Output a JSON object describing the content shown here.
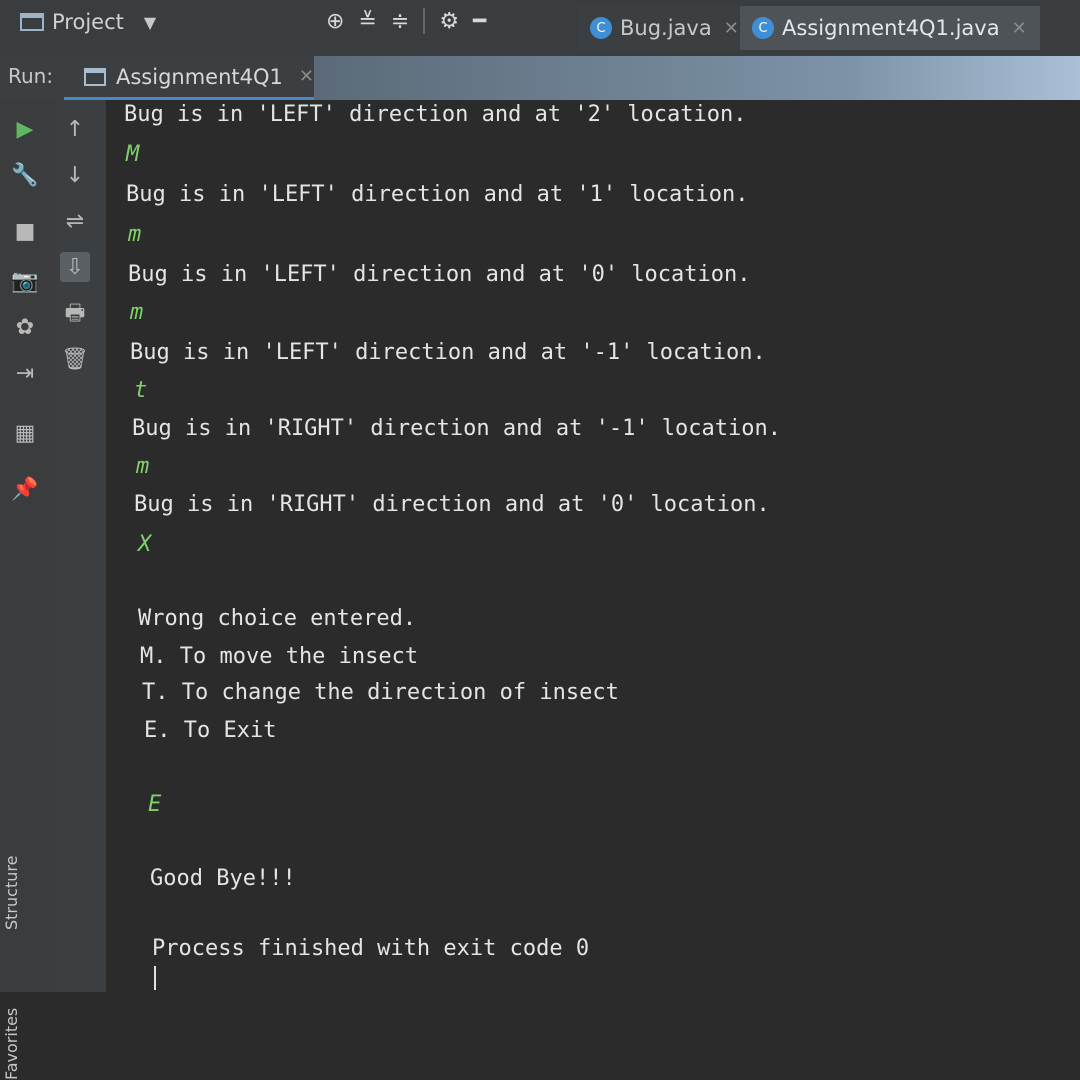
{
  "toolbar": {
    "project_label": "Project",
    "tabs": [
      {
        "name": "Bug.java",
        "icon": "C"
      },
      {
        "name": "Assignment4Q1.java",
        "icon": "C"
      }
    ]
  },
  "run_panel": {
    "label": "Run:",
    "tab_name": "Assignment4Q1",
    "side_labels": {
      "structure": "Structure",
      "favorites": "Favorites"
    }
  },
  "console": {
    "lines": [
      {
        "text": "Bug is in 'LEFT' direction and at '2' location.",
        "kind": "output"
      },
      {
        "text": "M",
        "kind": "input"
      },
      {
        "text": "Bug is in 'LEFT' direction and at '1' location.",
        "kind": "output"
      },
      {
        "text": "m",
        "kind": "input"
      },
      {
        "text": "Bug is in 'LEFT' direction and at '0' location.",
        "kind": "output"
      },
      {
        "text": "m",
        "kind": "input"
      },
      {
        "text": "Bug is in 'LEFT' direction and at '-1' location.",
        "kind": "output"
      },
      {
        "text": "t",
        "kind": "input"
      },
      {
        "text": "Bug is in 'RIGHT' direction and at '-1' location.",
        "kind": "output"
      },
      {
        "text": "m",
        "kind": "input"
      },
      {
        "text": "Bug is in 'RIGHT' direction and at '0' location.",
        "kind": "output"
      },
      {
        "text": "X",
        "kind": "input"
      },
      {
        "text": "Wrong choice entered.",
        "kind": "output"
      },
      {
        "text": "M. To move the insect",
        "kind": "output"
      },
      {
        "text": "T. To change the direction of insect",
        "kind": "output"
      },
      {
        "text": "E. To Exit",
        "kind": "output"
      },
      {
        "text": "E",
        "kind": "input"
      },
      {
        "text": "Good Bye!!!",
        "kind": "output"
      },
      {
        "text": "Process finished with exit code 0",
        "kind": "output"
      }
    ]
  },
  "colors": {
    "input_text": "#7fcf6a",
    "output_text": "#e4e4e4",
    "background": "#2b2b2b"
  }
}
